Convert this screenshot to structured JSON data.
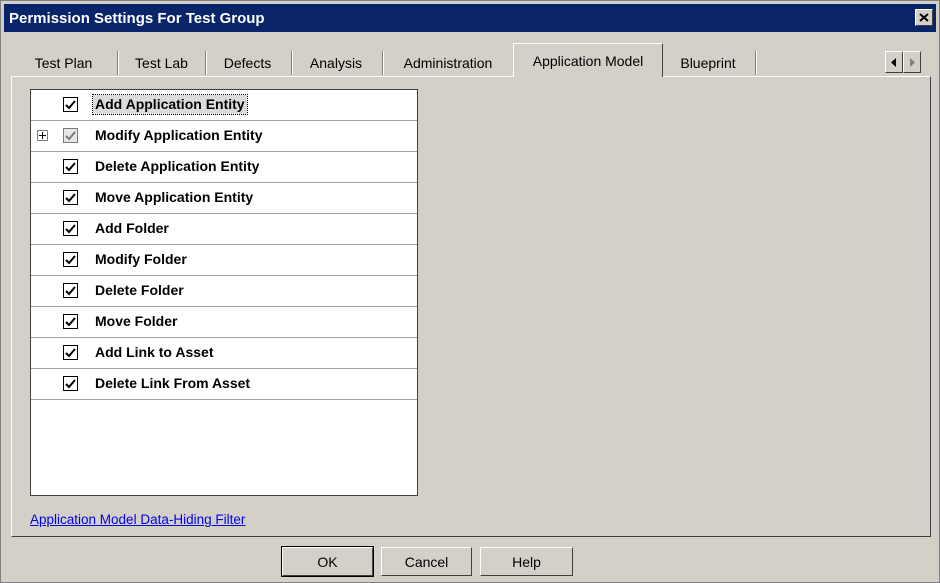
{
  "window": {
    "title": "Permission Settings For Test Group"
  },
  "tabs": [
    {
      "label": "Test Plan"
    },
    {
      "label": "Test Lab"
    },
    {
      "label": "Defects"
    },
    {
      "label": "Analysis"
    },
    {
      "label": "Administration"
    },
    {
      "label": "Application Model",
      "active": true
    },
    {
      "label": "Blueprint"
    }
  ],
  "permissions": [
    {
      "label": "Add Application Entity",
      "checked": true,
      "selected": true
    },
    {
      "label": "Modify Application Entity",
      "checked": true,
      "expandable": true,
      "indeterminate": true
    },
    {
      "label": "Delete Application Entity",
      "checked": true
    },
    {
      "label": "Move Application Entity",
      "checked": true
    },
    {
      "label": "Add Folder",
      "checked": true
    },
    {
      "label": "Modify Folder",
      "checked": true
    },
    {
      "label": "Delete Folder",
      "checked": true
    },
    {
      "label": "Move Folder",
      "checked": true
    },
    {
      "label": "Add Link to Asset",
      "checked": true
    },
    {
      "label": "Delete Link From Asset",
      "checked": true
    }
  ],
  "filter_link": "Application Model Data-Hiding Filter",
  "buttons": {
    "ok": "OK",
    "cancel": "Cancel",
    "help": "Help"
  },
  "icons": {
    "close": "close-icon",
    "scroll_left": "arrow-left-icon",
    "scroll_right": "arrow-right-icon",
    "check": "checkmark-icon",
    "expand": "plus-icon"
  }
}
